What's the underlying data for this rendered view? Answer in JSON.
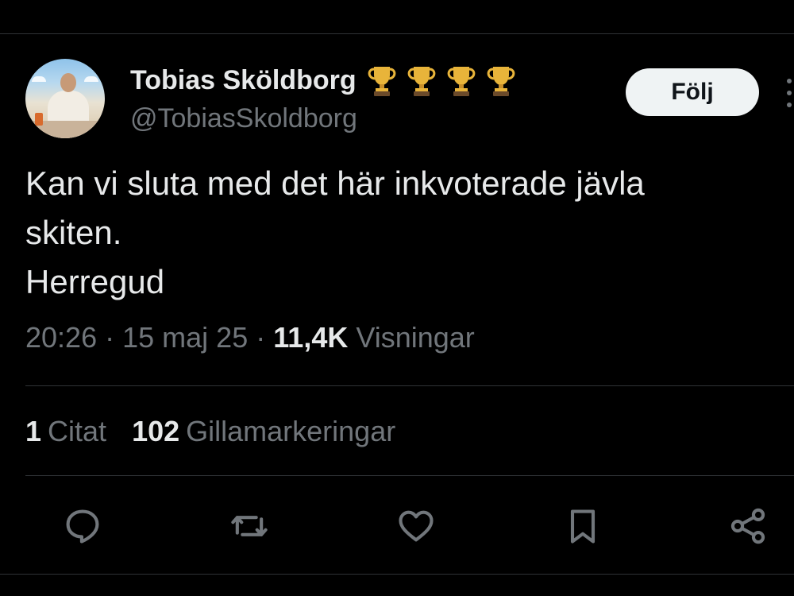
{
  "author": {
    "display_name": "Tobias Sköldborg",
    "handle": "@TobiasSkoldborg",
    "badges": [
      "trophy-icon",
      "trophy-icon",
      "trophy-icon",
      "trophy-icon"
    ]
  },
  "follow_button": {
    "label": "Följ"
  },
  "post": {
    "text": "Kan vi sluta med det här inkvoterade jävla\nskiten.\nHerregud"
  },
  "meta": {
    "time": "20:26",
    "separator": "·",
    "date": "15 maj 25",
    "views_count": "11,4K",
    "views_label": "Visningar"
  },
  "stats": {
    "quotes_count": "1",
    "quotes_label": "Citat",
    "likes_count": "102",
    "likes_label": "Gillamarkeringar"
  },
  "actions": [
    "reply-icon",
    "repost-icon",
    "like-icon",
    "bookmark-icon",
    "share-icon"
  ],
  "colors": {
    "background": "#000000",
    "primary_text": "#e7e9ea",
    "secondary_text": "#71767b",
    "divider": "#2f3336",
    "follow_button_bg": "#eff3f4",
    "follow_button_text": "#0f1419"
  }
}
